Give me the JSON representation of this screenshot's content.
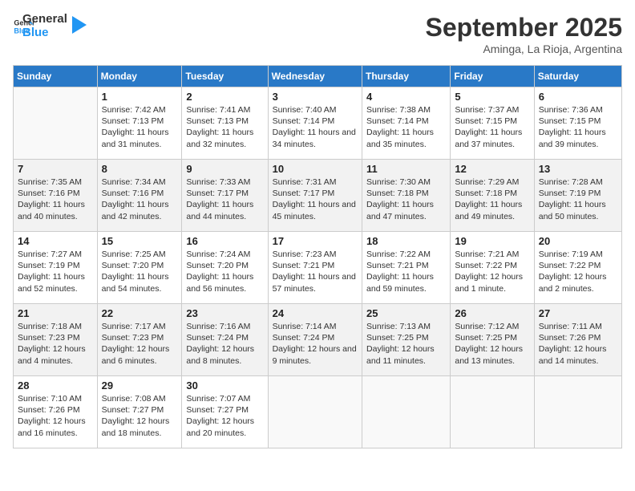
{
  "header": {
    "logo_general": "General",
    "logo_blue": "Blue",
    "title": "September 2025",
    "subtitle": "Aminga, La Rioja, Argentina"
  },
  "days_of_week": [
    "Sunday",
    "Monday",
    "Tuesday",
    "Wednesday",
    "Thursday",
    "Friday",
    "Saturday"
  ],
  "weeks": [
    [
      {
        "day": "",
        "sunrise": "",
        "sunset": "",
        "daylight": ""
      },
      {
        "day": "1",
        "sunrise": "Sunrise: 7:42 AM",
        "sunset": "Sunset: 7:13 PM",
        "daylight": "Daylight: 11 hours and 31 minutes."
      },
      {
        "day": "2",
        "sunrise": "Sunrise: 7:41 AM",
        "sunset": "Sunset: 7:13 PM",
        "daylight": "Daylight: 11 hours and 32 minutes."
      },
      {
        "day": "3",
        "sunrise": "Sunrise: 7:40 AM",
        "sunset": "Sunset: 7:14 PM",
        "daylight": "Daylight: 11 hours and 34 minutes."
      },
      {
        "day": "4",
        "sunrise": "Sunrise: 7:38 AM",
        "sunset": "Sunset: 7:14 PM",
        "daylight": "Daylight: 11 hours and 35 minutes."
      },
      {
        "day": "5",
        "sunrise": "Sunrise: 7:37 AM",
        "sunset": "Sunset: 7:15 PM",
        "daylight": "Daylight: 11 hours and 37 minutes."
      },
      {
        "day": "6",
        "sunrise": "Sunrise: 7:36 AM",
        "sunset": "Sunset: 7:15 PM",
        "daylight": "Daylight: 11 hours and 39 minutes."
      }
    ],
    [
      {
        "day": "7",
        "sunrise": "Sunrise: 7:35 AM",
        "sunset": "Sunset: 7:16 PM",
        "daylight": "Daylight: 11 hours and 40 minutes."
      },
      {
        "day": "8",
        "sunrise": "Sunrise: 7:34 AM",
        "sunset": "Sunset: 7:16 PM",
        "daylight": "Daylight: 11 hours and 42 minutes."
      },
      {
        "day": "9",
        "sunrise": "Sunrise: 7:33 AM",
        "sunset": "Sunset: 7:17 PM",
        "daylight": "Daylight: 11 hours and 44 minutes."
      },
      {
        "day": "10",
        "sunrise": "Sunrise: 7:31 AM",
        "sunset": "Sunset: 7:17 PM",
        "daylight": "Daylight: 11 hours and 45 minutes."
      },
      {
        "day": "11",
        "sunrise": "Sunrise: 7:30 AM",
        "sunset": "Sunset: 7:18 PM",
        "daylight": "Daylight: 11 hours and 47 minutes."
      },
      {
        "day": "12",
        "sunrise": "Sunrise: 7:29 AM",
        "sunset": "Sunset: 7:18 PM",
        "daylight": "Daylight: 11 hours and 49 minutes."
      },
      {
        "day": "13",
        "sunrise": "Sunrise: 7:28 AM",
        "sunset": "Sunset: 7:19 PM",
        "daylight": "Daylight: 11 hours and 50 minutes."
      }
    ],
    [
      {
        "day": "14",
        "sunrise": "Sunrise: 7:27 AM",
        "sunset": "Sunset: 7:19 PM",
        "daylight": "Daylight: 11 hours and 52 minutes."
      },
      {
        "day": "15",
        "sunrise": "Sunrise: 7:25 AM",
        "sunset": "Sunset: 7:20 PM",
        "daylight": "Daylight: 11 hours and 54 minutes."
      },
      {
        "day": "16",
        "sunrise": "Sunrise: 7:24 AM",
        "sunset": "Sunset: 7:20 PM",
        "daylight": "Daylight: 11 hours and 56 minutes."
      },
      {
        "day": "17",
        "sunrise": "Sunrise: 7:23 AM",
        "sunset": "Sunset: 7:21 PM",
        "daylight": "Daylight: 11 hours and 57 minutes."
      },
      {
        "day": "18",
        "sunrise": "Sunrise: 7:22 AM",
        "sunset": "Sunset: 7:21 PM",
        "daylight": "Daylight: 11 hours and 59 minutes."
      },
      {
        "day": "19",
        "sunrise": "Sunrise: 7:21 AM",
        "sunset": "Sunset: 7:22 PM",
        "daylight": "Daylight: 12 hours and 1 minute."
      },
      {
        "day": "20",
        "sunrise": "Sunrise: 7:19 AM",
        "sunset": "Sunset: 7:22 PM",
        "daylight": "Daylight: 12 hours and 2 minutes."
      }
    ],
    [
      {
        "day": "21",
        "sunrise": "Sunrise: 7:18 AM",
        "sunset": "Sunset: 7:23 PM",
        "daylight": "Daylight: 12 hours and 4 minutes."
      },
      {
        "day": "22",
        "sunrise": "Sunrise: 7:17 AM",
        "sunset": "Sunset: 7:23 PM",
        "daylight": "Daylight: 12 hours and 6 minutes."
      },
      {
        "day": "23",
        "sunrise": "Sunrise: 7:16 AM",
        "sunset": "Sunset: 7:24 PM",
        "daylight": "Daylight: 12 hours and 8 minutes."
      },
      {
        "day": "24",
        "sunrise": "Sunrise: 7:14 AM",
        "sunset": "Sunset: 7:24 PM",
        "daylight": "Daylight: 12 hours and 9 minutes."
      },
      {
        "day": "25",
        "sunrise": "Sunrise: 7:13 AM",
        "sunset": "Sunset: 7:25 PM",
        "daylight": "Daylight: 12 hours and 11 minutes."
      },
      {
        "day": "26",
        "sunrise": "Sunrise: 7:12 AM",
        "sunset": "Sunset: 7:25 PM",
        "daylight": "Daylight: 12 hours and 13 minutes."
      },
      {
        "day": "27",
        "sunrise": "Sunrise: 7:11 AM",
        "sunset": "Sunset: 7:26 PM",
        "daylight": "Daylight: 12 hours and 14 minutes."
      }
    ],
    [
      {
        "day": "28",
        "sunrise": "Sunrise: 7:10 AM",
        "sunset": "Sunset: 7:26 PM",
        "daylight": "Daylight: 12 hours and 16 minutes."
      },
      {
        "day": "29",
        "sunrise": "Sunrise: 7:08 AM",
        "sunset": "Sunset: 7:27 PM",
        "daylight": "Daylight: 12 hours and 18 minutes."
      },
      {
        "day": "30",
        "sunrise": "Sunrise: 7:07 AM",
        "sunset": "Sunset: 7:27 PM",
        "daylight": "Daylight: 12 hours and 20 minutes."
      },
      {
        "day": "",
        "sunrise": "",
        "sunset": "",
        "daylight": ""
      },
      {
        "day": "",
        "sunrise": "",
        "sunset": "",
        "daylight": ""
      },
      {
        "day": "",
        "sunrise": "",
        "sunset": "",
        "daylight": ""
      },
      {
        "day": "",
        "sunrise": "",
        "sunset": "",
        "daylight": ""
      }
    ]
  ]
}
